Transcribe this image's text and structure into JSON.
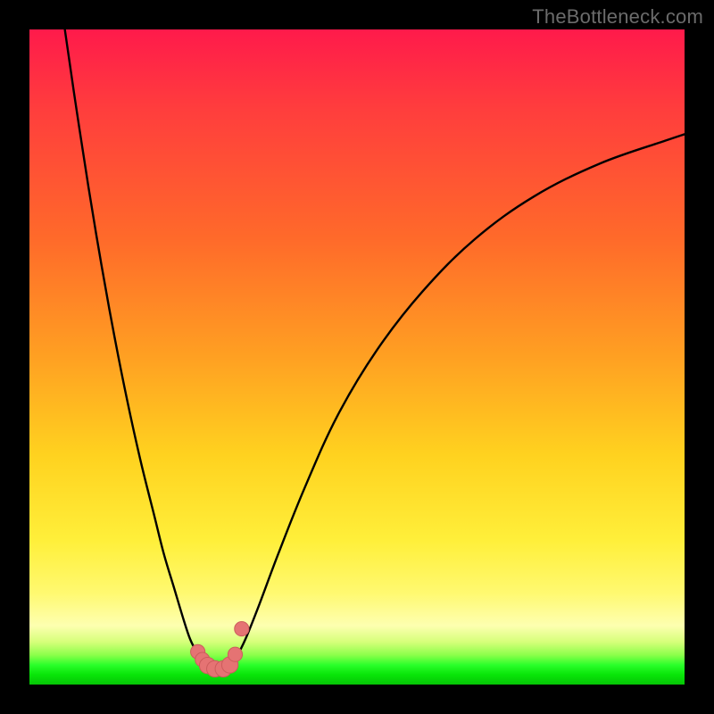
{
  "watermark": "TheBottleneck.com",
  "colors": {
    "frame": "#000000",
    "curve": "#000000",
    "marker_fill": "#e57373",
    "marker_stroke": "#cc5c5c",
    "gradient_top": "#ff1a4b",
    "gradient_bottom": "#06c506"
  },
  "chart_data": {
    "type": "line",
    "title": "",
    "xlabel": "",
    "ylabel": "",
    "xlim": [
      0,
      100
    ],
    "ylim": [
      0,
      100
    ],
    "note": "Axes are unlabeled in the source image; x is a normalized horizontal parameter (0–100) and y is bottleneck percentage (0 = optimal/green, 100 = worst/red). Values are estimated from pixel positions.",
    "series": [
      {
        "name": "left-branch",
        "x": [
          5.4,
          7,
          9,
          11,
          13,
          15,
          17,
          19,
          20.5,
          22,
          23.5,
          24.5,
          25.5,
          26.5,
          27.3
        ],
        "y": [
          100,
          89,
          76,
          64,
          53,
          43,
          34,
          26,
          20,
          15,
          10,
          7,
          5,
          3.5,
          2.5
        ]
      },
      {
        "name": "right-branch",
        "x": [
          30.5,
          31.5,
          33,
          35,
          38,
          42,
          47,
          53,
          60,
          68,
          77,
          87,
          97,
          100
        ],
        "y": [
          2.5,
          4,
          7,
          12,
          20,
          30,
          41,
          51,
          60,
          68,
          74.5,
          79.5,
          83,
          84
        ]
      },
      {
        "name": "valley-floor",
        "x": [
          27.3,
          28,
          29,
          30,
          30.5
        ],
        "y": [
          2.5,
          2.2,
          2.1,
          2.2,
          2.5
        ]
      }
    ],
    "markers": {
      "name": "valley-markers",
      "points": [
        {
          "x": 25.7,
          "y": 5.0,
          "r": 1.1
        },
        {
          "x": 26.4,
          "y": 3.8,
          "r": 1.1
        },
        {
          "x": 27.2,
          "y": 2.9,
          "r": 1.25
        },
        {
          "x": 28.3,
          "y": 2.4,
          "r": 1.25
        },
        {
          "x": 29.6,
          "y": 2.4,
          "r": 1.25
        },
        {
          "x": 30.6,
          "y": 3.0,
          "r": 1.25
        },
        {
          "x": 31.4,
          "y": 4.6,
          "r": 1.1
        },
        {
          "x": 32.4,
          "y": 8.5,
          "r": 1.1
        }
      ]
    }
  }
}
